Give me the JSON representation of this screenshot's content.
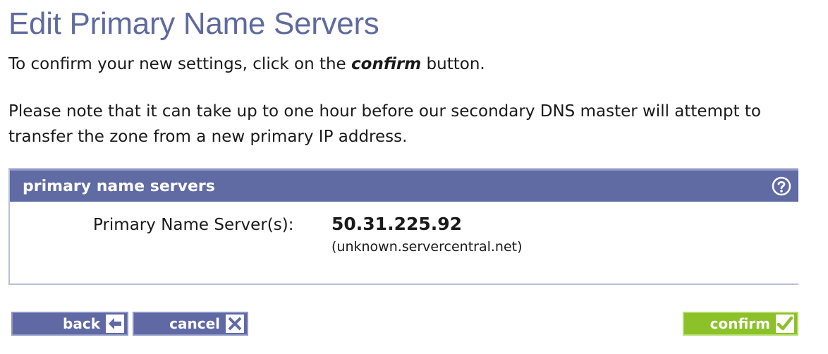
{
  "page": {
    "title": "Edit Primary Name Servers",
    "intro_before": "To confirm your new settings, click on the ",
    "intro_emphasis": "confirm",
    "intro_after": " button.",
    "note": "Please note that it can take up to one hour before our secondary DNS master will attempt to transfer the zone from a new primary IP address."
  },
  "panel": {
    "title": "primary name servers",
    "help_icon": "question-circle-icon",
    "field_label": "Primary Name Server(s):",
    "ip": "50.31.225.92",
    "hostname": "(unknown.servercentral.net)"
  },
  "buttons": {
    "back": {
      "label": "back",
      "icon": "arrow-left-icon"
    },
    "cancel": {
      "label": "cancel",
      "icon": "close-x-icon"
    },
    "confirm": {
      "label": "confirm",
      "icon": "checkmark-icon"
    }
  },
  "colors": {
    "title": "#5f6a9e",
    "header_bg": "#606aa3",
    "button_blue": "#6069a4",
    "button_green": "#8cc12a"
  }
}
